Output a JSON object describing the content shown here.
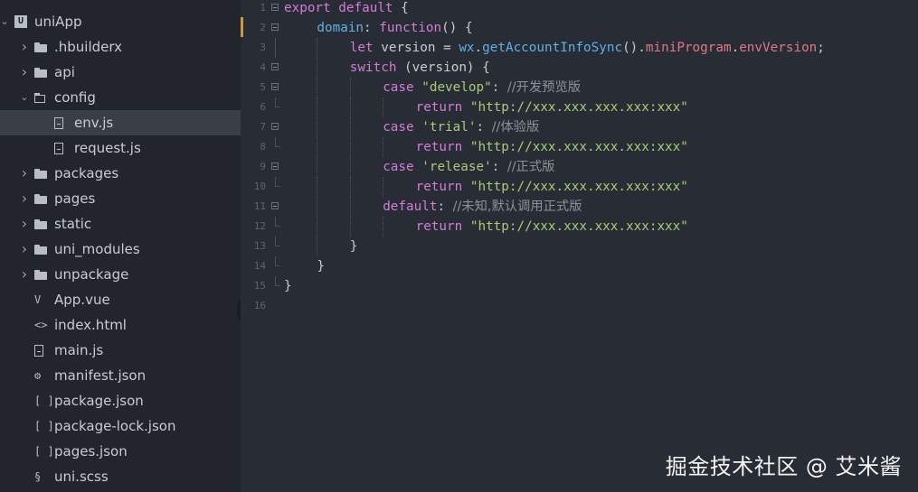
{
  "sidebar": {
    "items": [
      {
        "label": "uniApp",
        "kind": "project",
        "expanded": true,
        "depth": 0
      },
      {
        "label": ".hbuilderx",
        "kind": "folder",
        "depth": 1
      },
      {
        "label": "api",
        "kind": "folder",
        "depth": 1
      },
      {
        "label": "config",
        "kind": "folder-open",
        "expanded": true,
        "depth": 1
      },
      {
        "label": "env.js",
        "kind": "file",
        "depth": 2,
        "selected": true
      },
      {
        "label": "request.js",
        "kind": "file",
        "depth": 2
      },
      {
        "label": "packages",
        "kind": "folder",
        "depth": 1
      },
      {
        "label": "pages",
        "kind": "folder",
        "depth": 1
      },
      {
        "label": "static",
        "kind": "folder",
        "depth": 1
      },
      {
        "label": "uni_modules",
        "kind": "folder",
        "depth": 1
      },
      {
        "label": "unpackage",
        "kind": "folder",
        "depth": 1
      },
      {
        "label": "App.vue",
        "kind": "vue-file",
        "depth": 1
      },
      {
        "label": "index.html",
        "kind": "html-file",
        "depth": 1
      },
      {
        "label": "main.js",
        "kind": "file",
        "depth": 1
      },
      {
        "label": "manifest.json",
        "kind": "gear-file",
        "depth": 1
      },
      {
        "label": "package.json",
        "kind": "json-file",
        "depth": 1
      },
      {
        "label": "package-lock.json",
        "kind": "json-file",
        "depth": 1
      },
      {
        "label": "pages.json",
        "kind": "json-file",
        "depth": 1
      },
      {
        "label": "uni.scss",
        "kind": "style-file",
        "depth": 1
      }
    ],
    "collapse_toggle": "‹"
  },
  "editor": {
    "lines": [
      {
        "n": "1",
        "tokens": [
          [
            "kw",
            "export"
          ],
          [
            "pl",
            " "
          ],
          [
            "kw",
            "default"
          ],
          [
            "pl",
            " {"
          ]
        ],
        "indent": 0,
        "fold": "open"
      },
      {
        "n": "2",
        "tokens": [
          [
            "prop",
            "domain"
          ],
          [
            "pl",
            ": "
          ],
          [
            "kw",
            "function"
          ],
          [
            "pl",
            "() {"
          ]
        ],
        "indent": 1,
        "fold": "open"
      },
      {
        "n": "3",
        "tokens": [
          [
            "kw",
            "let"
          ],
          [
            "pl",
            " version = "
          ],
          [
            "fn",
            "wx"
          ],
          [
            "pl",
            "."
          ],
          [
            "fn",
            "getAccountInfoSync"
          ],
          [
            "pl",
            "()."
          ],
          [
            "mem",
            "miniProgram"
          ],
          [
            "pl",
            "."
          ],
          [
            "mem",
            "envVersion"
          ],
          [
            "pl",
            ";"
          ]
        ],
        "indent": 2,
        "fold": "line"
      },
      {
        "n": "4",
        "tokens": [
          [
            "kw",
            "switch"
          ],
          [
            "pl",
            " (version) {"
          ]
        ],
        "indent": 2,
        "fold": "open"
      },
      {
        "n": "5",
        "tokens": [
          [
            "kw",
            "case"
          ],
          [
            "pl",
            " "
          ],
          [
            "str",
            "\"develop\""
          ],
          [
            "pl",
            ": "
          ],
          [
            "cm",
            "//开发预览版"
          ]
        ],
        "indent": 3,
        "fold": "open"
      },
      {
        "n": "6",
        "tokens": [
          [
            "kw",
            "return"
          ],
          [
            "pl",
            " "
          ],
          [
            "str",
            "\"http://xxx.xxx.xxx.xxx:xxx\""
          ]
        ],
        "indent": 4,
        "fold": "end"
      },
      {
        "n": "7",
        "tokens": [
          [
            "kw",
            "case"
          ],
          [
            "pl",
            " "
          ],
          [
            "str",
            "'trial'"
          ],
          [
            "pl",
            ": "
          ],
          [
            "cm",
            "//体验版"
          ]
        ],
        "indent": 3,
        "fold": "open"
      },
      {
        "n": "8",
        "tokens": [
          [
            "kw",
            "return"
          ],
          [
            "pl",
            " "
          ],
          [
            "str",
            "\"http://xxx.xxx.xxx.xxx:xxx\""
          ]
        ],
        "indent": 4,
        "fold": "end"
      },
      {
        "n": "9",
        "tokens": [
          [
            "kw",
            "case"
          ],
          [
            "pl",
            " "
          ],
          [
            "str",
            "'release'"
          ],
          [
            "pl",
            ": "
          ],
          [
            "cm",
            "//正式版"
          ]
        ],
        "indent": 3,
        "fold": "open"
      },
      {
        "n": "10",
        "tokens": [
          [
            "kw",
            "return"
          ],
          [
            "pl",
            " "
          ],
          [
            "str",
            "\"http://xxx.xxx.xxx.xxx:xxx\""
          ]
        ],
        "indent": 4,
        "fold": "end"
      },
      {
        "n": "11",
        "tokens": [
          [
            "kw",
            "default"
          ],
          [
            "pl",
            ": "
          ],
          [
            "cm",
            "//未知,默认调用正式版"
          ]
        ],
        "indent": 3,
        "fold": "open"
      },
      {
        "n": "12",
        "tokens": [
          [
            "kw",
            "return"
          ],
          [
            "pl",
            " "
          ],
          [
            "str",
            "\"http://xxx.xxx.xxx.xxx:xxx\""
          ]
        ],
        "indent": 4,
        "fold": "end"
      },
      {
        "n": "13",
        "tokens": [
          [
            "pl",
            "}"
          ]
        ],
        "indent": 2,
        "fold": "end"
      },
      {
        "n": "14",
        "tokens": [
          [
            "pl",
            "}"
          ]
        ],
        "indent": 1,
        "fold": "end"
      },
      {
        "n": "15",
        "tokens": [
          [
            "pl",
            "}"
          ]
        ],
        "indent": 0,
        "fold": "end"
      },
      {
        "n": "16",
        "tokens": [],
        "indent": 0,
        "fold": "none"
      }
    ]
  },
  "watermark": "掘金技术社区 @ 艾米酱",
  "colors": {
    "sidebar_bg": "#22252c",
    "editor_bg": "#282c34",
    "selected_bg": "#3a3e46",
    "keyword": "#d57bd8",
    "string": "#a7cd76",
    "property": "#5fb0e8",
    "comment": "#8b929c",
    "change_marker": "#c99b3a"
  }
}
